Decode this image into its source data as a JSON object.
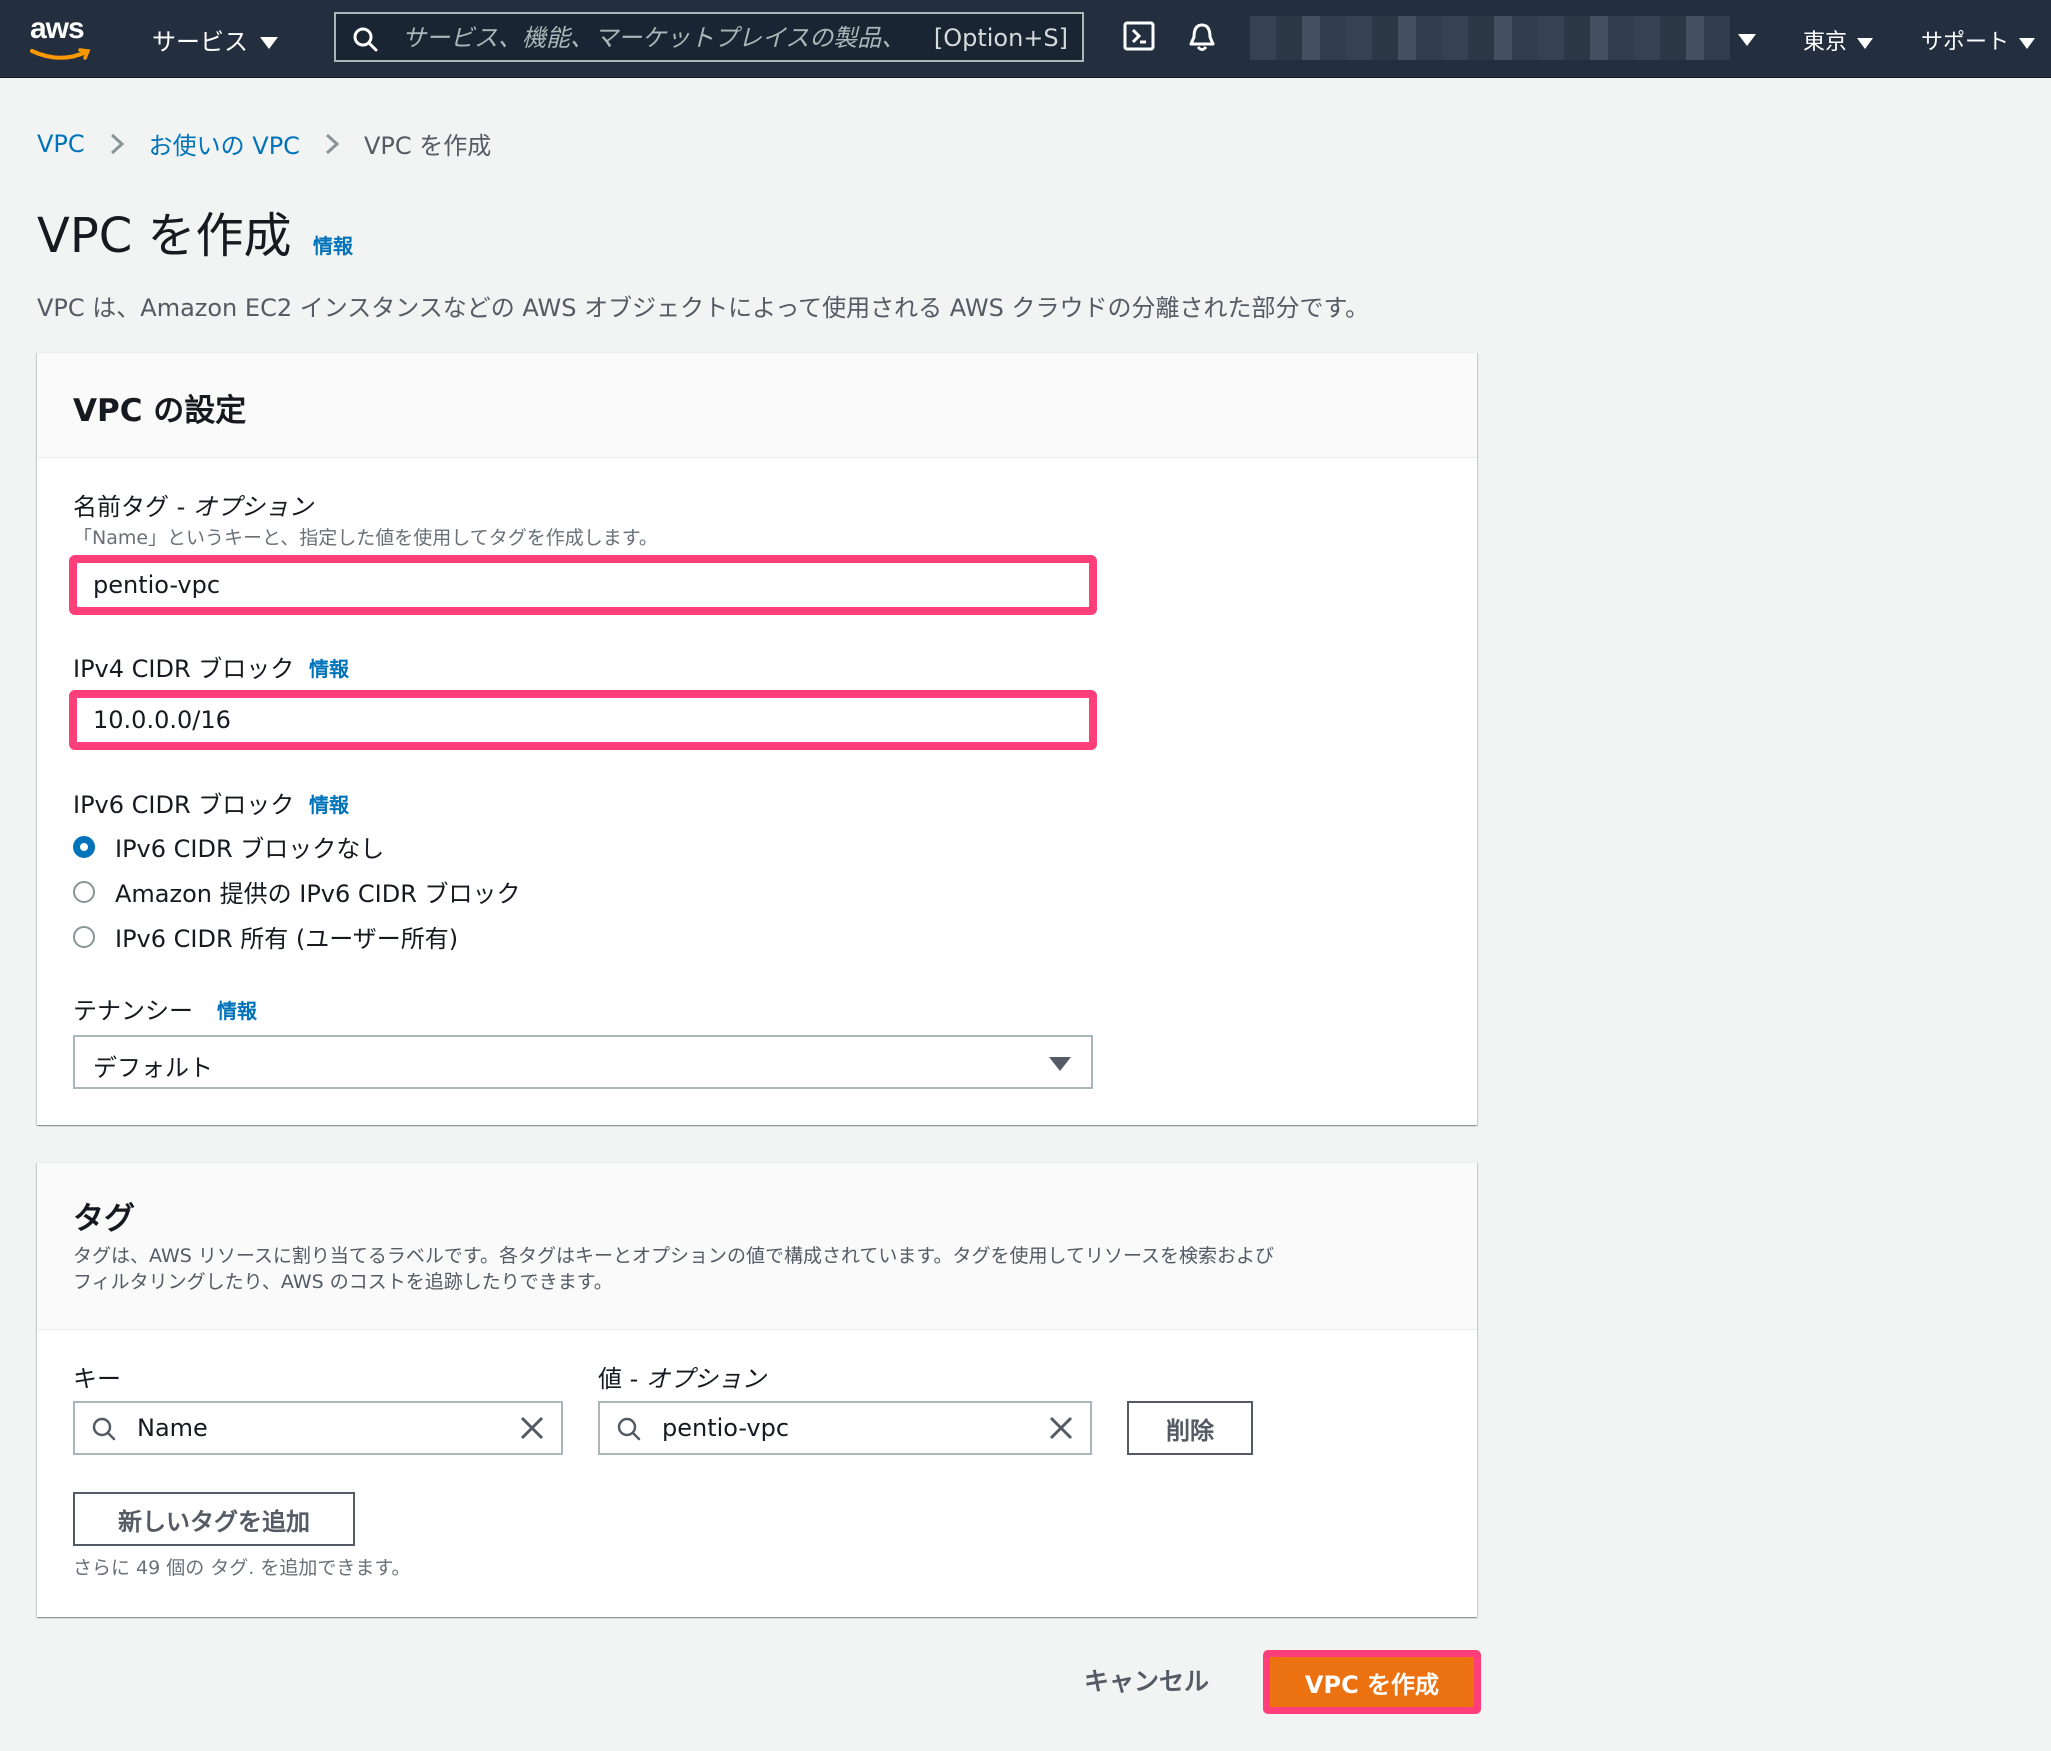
{
  "topnav": {
    "logo_text": "aws",
    "services_label": "サービス",
    "search_placeholder": "サービス、機能、マーケットプレイスの製品、",
    "search_shortcut": "[Option+S]",
    "region_label": "東京",
    "support_label": "サポート",
    "icons": [
      "cloudshell-icon",
      "bell-icon"
    ]
  },
  "breadcrumb": {
    "items": [
      "VPC",
      "お使いの VPC"
    ],
    "current": "VPC を作成"
  },
  "page": {
    "title": "VPC を作成",
    "info_label": "情報",
    "description": "VPC は、Amazon EC2 インスタンスなどの AWS オブジェクトによって使用される AWS クラウドの分離された部分です。"
  },
  "vpc_settings": {
    "title": "VPC の設定",
    "name_tag": {
      "label": "名前タグ - ",
      "label_optional": "オプション",
      "description": "「Name」というキーと、指定した値を使用してタグを作成します。",
      "value": "pentio-vpc"
    },
    "ipv4": {
      "label": "IPv4 CIDR ブロック",
      "info_label": "情報",
      "value": "10.0.0.0/16"
    },
    "ipv6": {
      "label": "IPv6 CIDR ブロック",
      "info_label": "情報",
      "options": [
        "IPv6 CIDR ブロックなし",
        "Amazon 提供の IPv6 CIDR ブロック",
        "IPv6 CIDR 所有 (ユーザー所有)"
      ],
      "selected_index": 0
    },
    "tenancy": {
      "label": "テナンシー",
      "info_label": "情報",
      "value": "デフォルト"
    }
  },
  "tags": {
    "title": "タグ",
    "description_line1": "タグは、AWS リソースに割り当てるラベルです。各タグはキーとオプションの値で構成されています。タグを使用してリソースを検索および",
    "description_line2": "フィルタリングしたり、AWS のコストを追跡したりできます。",
    "key_label": "キー",
    "value_label": "値 - ",
    "value_label_optional": "オプション",
    "key_value": "Name",
    "value_value": "pentio-vpc",
    "remove_label": "削除",
    "add_label": "新しいタグを追加",
    "remaining_text": "さらに 49 個の タグ. を追加できます。"
  },
  "footer": {
    "cancel_label": "キャンセル",
    "create_label": "VPC を作成"
  },
  "colors": {
    "nav_bg": "#232f3e",
    "link": "#0073bb",
    "primary": "#ec7211",
    "highlight": "#ff3e7a"
  }
}
